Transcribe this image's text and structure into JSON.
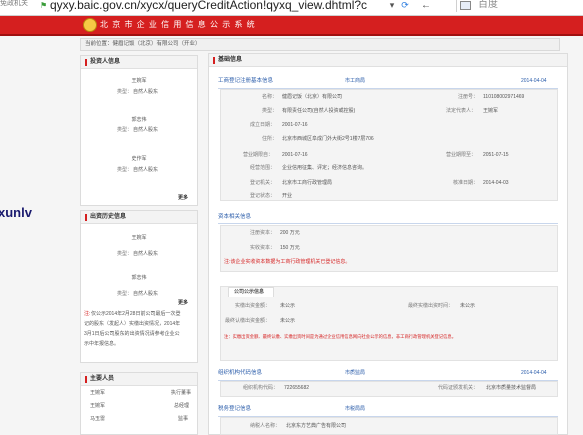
{
  "browser": {
    "tab_fragment": "免政机关",
    "address_url": "qyxy.baic.gov.cn/xycx/queryCreditAction!qyxq_view.dhtml?c",
    "search_placeholder": "百度",
    "icons": [
      "shield-icon",
      "dropdown-icon",
      "refresh-icon",
      "back-arrow-icon",
      "search-engine-icon"
    ]
  },
  "site": {
    "title": "北 京 市 企 业 信 用 信 息 公 示 系 统",
    "breadcrumb": "当前位置：健眉记饭（北京）有限公司（开业）",
    "brand_color": "#d51f1f"
  },
  "watermark": "xunlv",
  "sidebar": {
    "investors": {
      "title": "投资人信息",
      "entries": [
        {
          "name": "王婉军",
          "type_label": "类型：",
          "type": "自然人股东"
        },
        {
          "name": "郭志伟",
          "type_label": "类型：",
          "type": "自然人股东"
        },
        {
          "name": "史作军",
          "type_label": "类型：",
          "type": "自然人股东"
        }
      ],
      "more": "更多"
    },
    "history": {
      "title": "出资历史信息",
      "entries": [
        {
          "name": "王婉军",
          "type_label": "类型：",
          "type": "自然人股东"
        },
        {
          "name": "郭志伟",
          "type_label": "类型：",
          "type": "自然人股东"
        }
      ],
      "more": "更多",
      "note_prefix": "注:",
      "note": [
        "仅公示2014年2月28日前公司最后一次登",
        "记的股东（发起人）实缴出资情况，2014年",
        "3月1日后公司股东的出资情况请参考企业公",
        "示中年报信息。"
      ]
    },
    "members": {
      "title": "主要人员",
      "rows": [
        {
          "name": "王婉军",
          "role": "执行董事"
        },
        {
          "name": "王婉军",
          "role": "总经理"
        },
        {
          "name": "马玉雷",
          "role": "监事"
        }
      ]
    }
  },
  "main": {
    "title": "基础信息",
    "registration": {
      "head": "工商登记注册基本信息",
      "agency": "市工商局",
      "date": "2014-04-04",
      "name_label": "名称：",
      "name": "健眉记饭（北京）有限公司",
      "reg_no_label": "注册号：",
      "reg_no": "110108002971469",
      "type_label": "类型：",
      "type": "有限责任公司(自然人投资或控股)",
      "legal_rep_label": "法定代表人：",
      "legal_rep": "王婉军",
      "est_date_label": "成立日期：",
      "est_date": "2001-07-16",
      "address_label": "住所：",
      "address": "北京市西城区阜成门外大街2号1楼7层706",
      "term_from_label": "营业期限自：",
      "term_from": "2001-07-16",
      "term_to_label": "营业期限至：",
      "term_to": "2051-07-15",
      "scope_label": "经营范围：",
      "scope_line1": "企业信用征集、评定；经济信息咨询。",
      "scope_line2": "",
      "authority_label": "登记机关：",
      "authority": "北京市工商行政管理局",
      "approval_label": "核准日期：",
      "approval": "2014-04-03",
      "status_label": "登记状态：",
      "status": "开业"
    },
    "capital": {
      "head": "资本相关信息",
      "registered_label": "注册资本：",
      "registered": "200 万元",
      "paid_label": "实收资本：",
      "paid": "150 万元",
      "note": "注:该企业实收资本数据为工商行政管理机关已登记信息。"
    },
    "public_info": {
      "tab": "公司公示信息",
      "paid_amt_label": "实缴出资金额：",
      "paid_amt": "未公示",
      "paid_date_label": "最终实缴出资时间：",
      "paid_date": "未公示",
      "sub_amt_label": "最终认缴出资金额：",
      "sub_amt": "未公示",
      "note": "注：实缴出资金额、最终认缴、实缴出资时间是为通过企业信用信息网向社会公示的信息，非工商行政管理机关登记信息。"
    },
    "org_code": {
      "head": "组织机构代码信息",
      "agency": "市质监局",
      "date": "2014-04-04",
      "code_label": "组织机构代码：",
      "code": "722655682",
      "issuer_label": "代码证颁发机关：",
      "issuer": "北京市质量技术监督局"
    },
    "tax": {
      "head": "税务登记信息",
      "agency": "市税局局",
      "taxpayer_label": "纳税人名称：",
      "taxpayer": "北京东方艺典广告有限公司"
    }
  }
}
